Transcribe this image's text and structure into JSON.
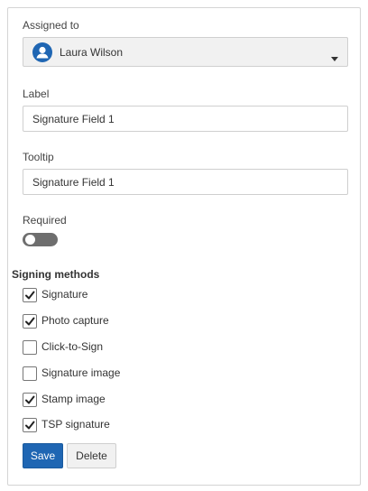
{
  "assigned_to": {
    "label": "Assigned to",
    "value": "Laura Wilson",
    "avatar_icon": "user-icon",
    "dropdown_icon": "caret-down-icon"
  },
  "label_field": {
    "label": "Label",
    "value": "Signature Field 1"
  },
  "tooltip_field": {
    "label": "Tooltip",
    "value": "Signature Field 1"
  },
  "required": {
    "label": "Required",
    "checked": false
  },
  "signing_methods": {
    "title": "Signing methods",
    "items": [
      {
        "label": "Signature",
        "checked": true
      },
      {
        "label": "Photo capture",
        "checked": true
      },
      {
        "label": "Click-to-Sign",
        "checked": false
      },
      {
        "label": "Signature image",
        "checked": false
      },
      {
        "label": "Stamp image",
        "checked": true
      },
      {
        "label": "TSP signature",
        "checked": true
      }
    ]
  },
  "actions": {
    "save_label": "Save",
    "delete_label": "Delete"
  },
  "colors": {
    "primary": "#1f66b3",
    "toggle_off": "#6e6e6e",
    "border": "#cfcfcf"
  }
}
